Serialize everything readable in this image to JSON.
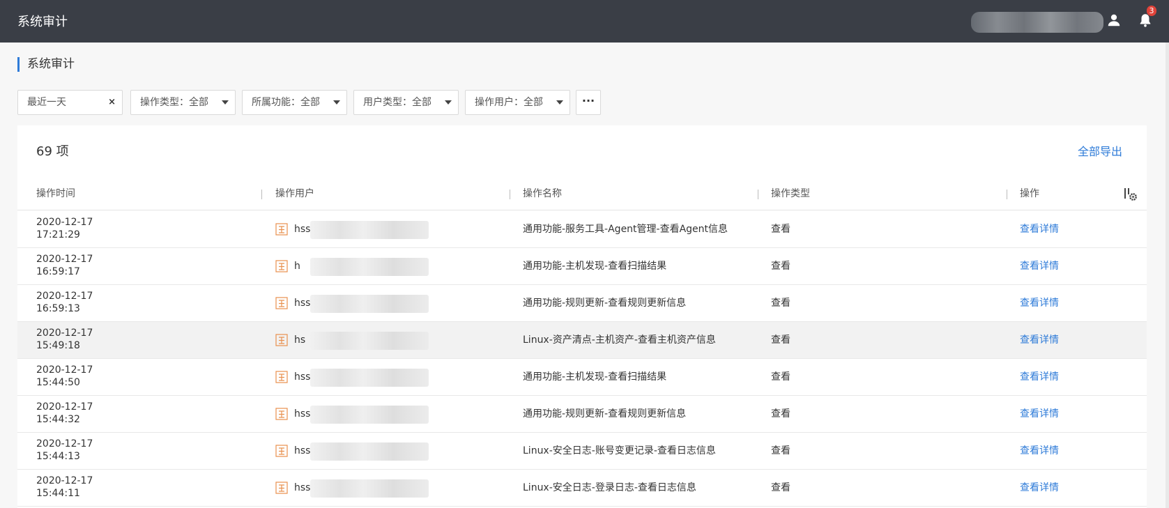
{
  "app": {
    "title": "系统审计",
    "notifications": "3"
  },
  "page": {
    "title": "系统审计"
  },
  "filters": {
    "date": "最近一天",
    "clear": "×",
    "op_type": "操作类型：全部",
    "feature": "所属功能：全部",
    "user_type": "用户类型：全部",
    "op_user": "操作用户：全部",
    "more": "···"
  },
  "table": {
    "count": "69 项",
    "export": "全部导出",
    "headers": [
      "操作时间",
      "操作用户",
      "操作名称",
      "操作类型",
      "操作"
    ],
    "rows": [
      {
        "date": "2020-12-17",
        "time": "17:21:29",
        "user": "hss",
        "op": "通用功能-服务工具-Agent管理-查看Agent信息",
        "type": "查看",
        "action": "查看详情"
      },
      {
        "date": "2020-12-17",
        "time": "16:59:17",
        "user": "h",
        "op": "通用功能-主机发现-查看扫描结果",
        "type": "查看",
        "action": "查看详情"
      },
      {
        "date": "2020-12-17",
        "time": "16:59:13",
        "user": "hss",
        "op": "通用功能-规则更新-查看规则更新信息",
        "type": "查看",
        "action": "查看详情"
      },
      {
        "date": "2020-12-17",
        "time": "15:49:18",
        "user": "hs",
        "op": "Linux-资产清点-主机资产-查看主机资产信息",
        "type": "查看",
        "action": "查看详情"
      },
      {
        "date": "2020-12-17",
        "time": "15:44:50",
        "user": "hss-",
        "op": "通用功能-主机发现-查看扫描结果",
        "type": "查看",
        "action": "查看详情"
      },
      {
        "date": "2020-12-17",
        "time": "15:44:32",
        "user": "hss",
        "op": "通用功能-规则更新-查看规则更新信息",
        "type": "查看",
        "action": "查看详情"
      },
      {
        "date": "2020-12-17",
        "time": "15:44:13",
        "user": "hss",
        "op": "Linux-安全日志-账号变更记录-查看日志信息",
        "type": "查看",
        "action": "查看详情"
      },
      {
        "date": "2020-12-17",
        "time": "15:44:11",
        "user": "hss",
        "op": "Linux-安全日志-登录日志-查看日志信息",
        "type": "查看",
        "action": "查看详情"
      }
    ]
  },
  "colors": {
    "topbar": "#3a3e46",
    "accent": "#2e7bd8",
    "user_icon": "#e8904e",
    "badge": "#e0433a"
  },
  "icons": {
    "user": "user-icon",
    "bell": "bell-icon",
    "column_settings": "column-settings-icon",
    "user_row": "user-account-icon"
  }
}
